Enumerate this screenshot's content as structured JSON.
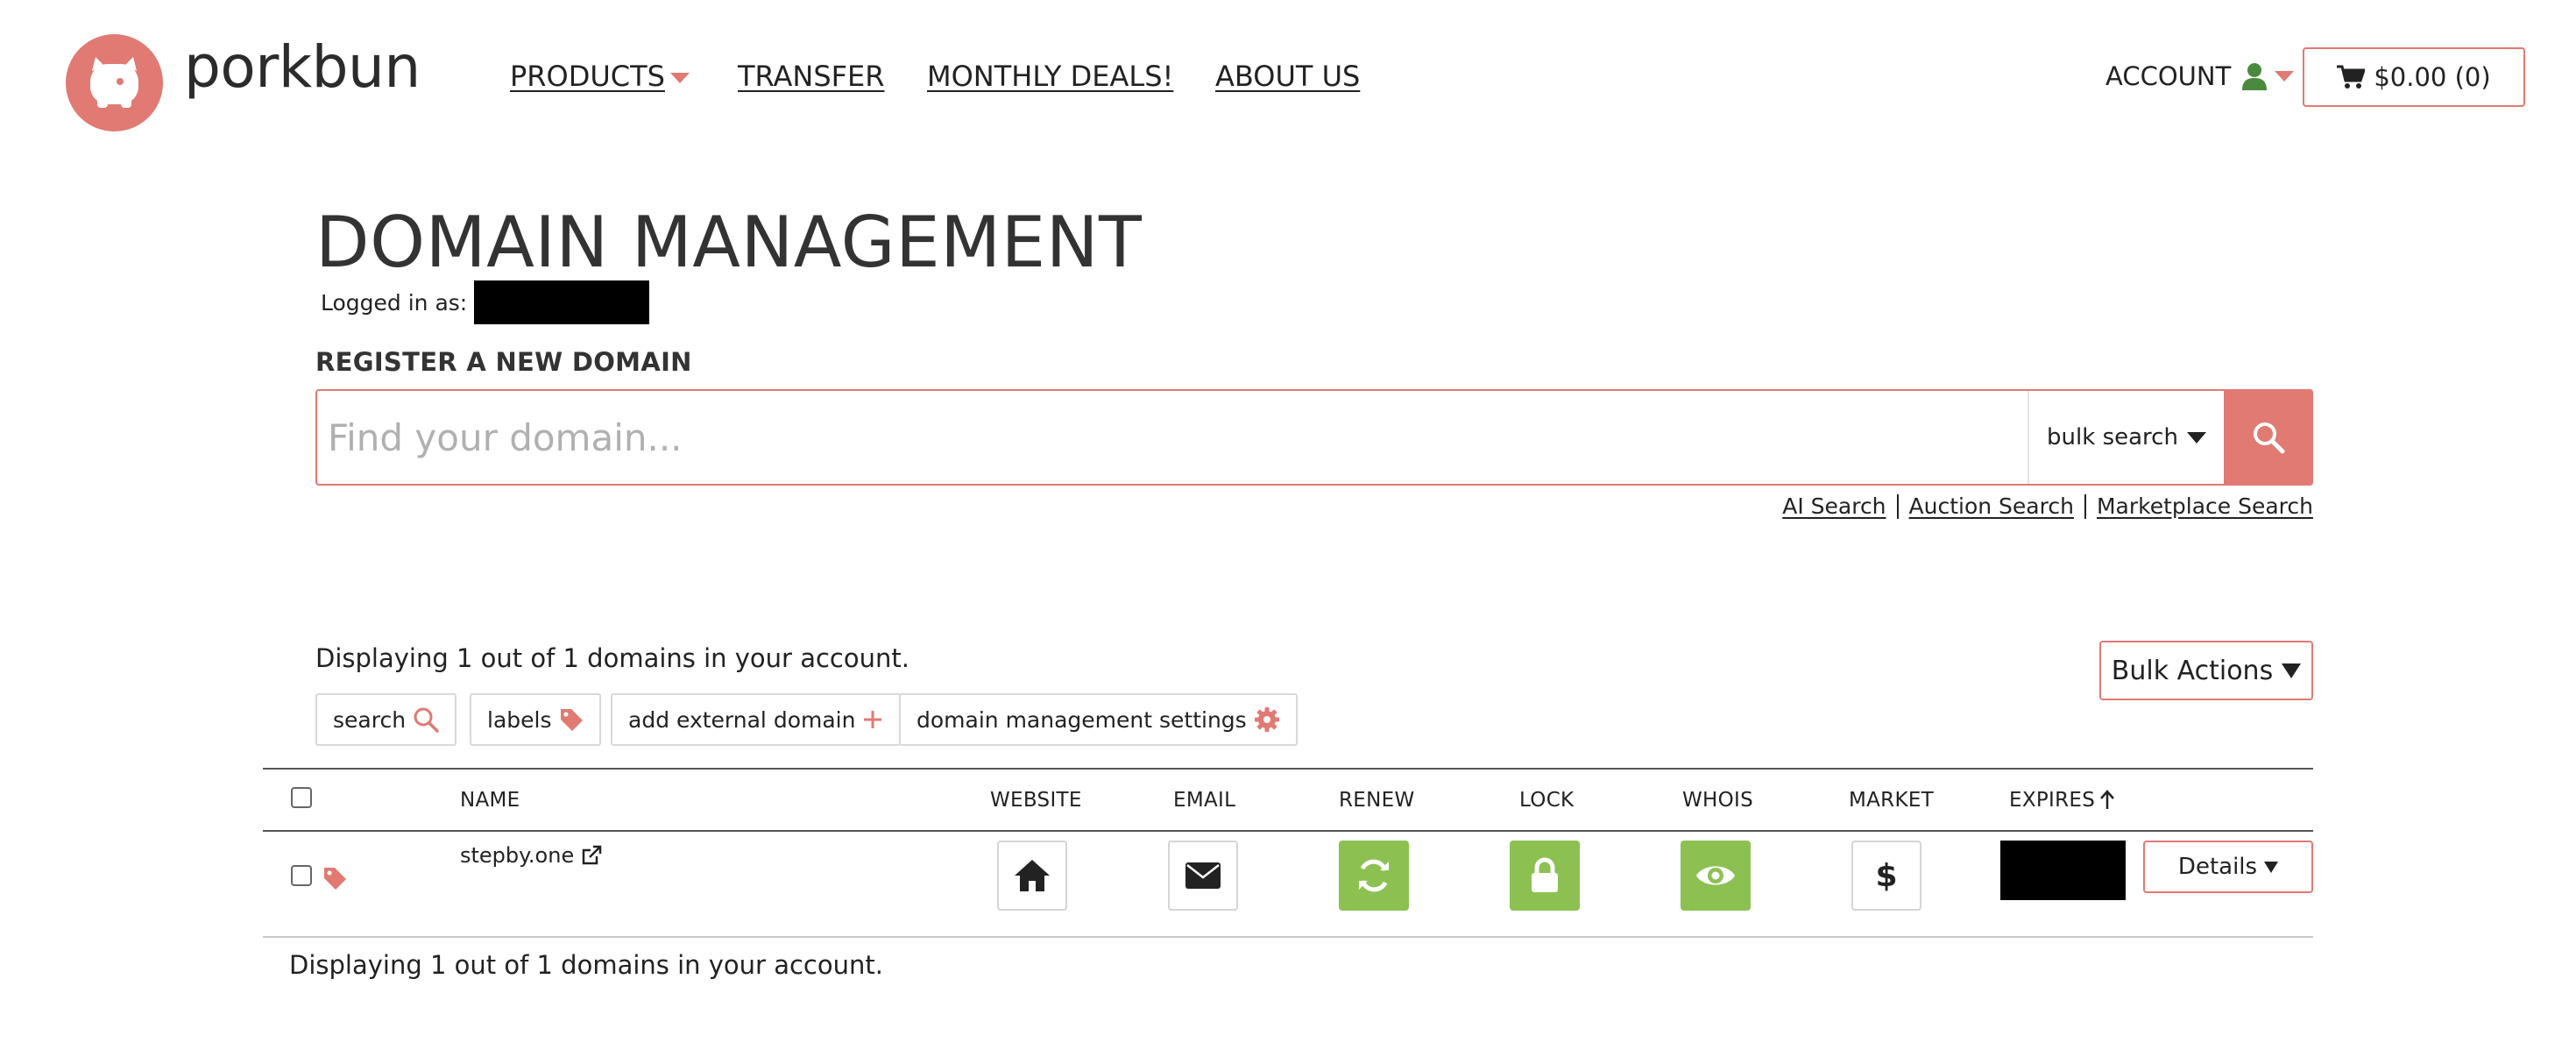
{
  "header": {
    "logo_text": "porkbun",
    "nav": [
      {
        "label": "PRODUCTS",
        "has_dropdown": true
      },
      {
        "label": "TRANSFER"
      },
      {
        "label": "MONTHLY DEALS!"
      },
      {
        "label": "ABOUT US"
      }
    ],
    "account_label": "ACCOUNT",
    "cart_label": "$0.00 (0)"
  },
  "main": {
    "title": "DOMAIN MANAGEMENT",
    "logged_in_label": "Logged in as:",
    "register_label": "REGISTER A NEW DOMAIN",
    "search_placeholder": "Find your domain...",
    "bulk_search_label": "bulk search",
    "sub_links": [
      "AI Search",
      "Auction Search",
      "Marketplace Search"
    ],
    "display_count": "Displaying 1 out of 1 domains in your account.",
    "bulk_actions_label": "Bulk Actions",
    "tools": [
      "search",
      "labels",
      "add external domain",
      "domain management settings"
    ]
  },
  "table": {
    "columns": [
      "NAME",
      "WEBSITE",
      "EMAIL",
      "RENEW",
      "LOCK",
      "WHOIS",
      "MARKET",
      "EXPIRES"
    ],
    "rows": [
      {
        "name": "stepby.one",
        "website_icon": "home-icon",
        "email_icon": "envelope-icon",
        "renew_icon": "refresh-icon",
        "renew_enabled": true,
        "lock_icon": "lock-icon",
        "lock_enabled": true,
        "whois_icon": "eye-icon",
        "whois_privacy_enabled": true,
        "market_icon": "dollar-icon",
        "details_label": "Details"
      }
    ]
  },
  "colors": {
    "accent": "#e07a73",
    "green": "#8cc152",
    "account_icon": "#4a8a3f"
  }
}
